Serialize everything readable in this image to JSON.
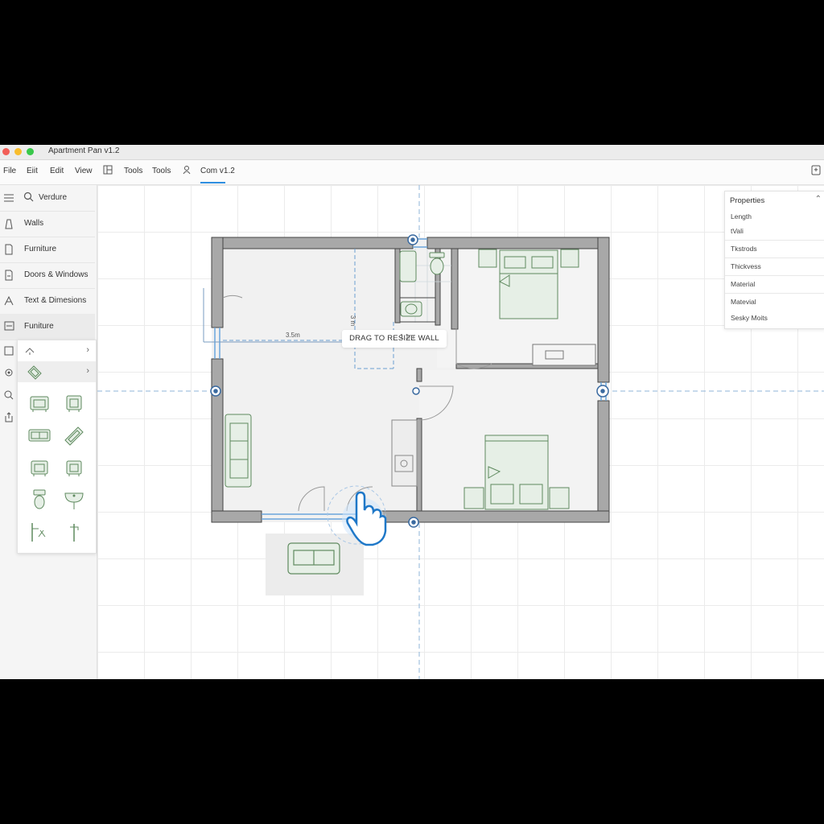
{
  "window": {
    "title": "Apartment Pan v1.2"
  },
  "menu": {
    "items": [
      "File",
      "Eiit",
      "Edit",
      "View",
      "Tools",
      "Tools"
    ],
    "active_tab": "Com v1.2"
  },
  "sidebar": {
    "search_placeholder": "Verdure",
    "items": [
      {
        "label": "Walls",
        "icon": "wall-icon"
      },
      {
        "label": "Furniture",
        "icon": "furniture-icon"
      },
      {
        "label": "Doors & Windows",
        "icon": "door-icon"
      },
      {
        "label": "Text & Dimesions",
        "icon": "text-dimension-icon"
      },
      {
        "label": "Funiture",
        "icon": "furniture-selected-icon",
        "selected": true
      }
    ]
  },
  "palette": {
    "items": [
      "armchair",
      "armchair",
      "loveseat",
      "sofa-angled",
      "armchair",
      "armchair",
      "toilet",
      "sink",
      "faucet-shower",
      "faucet"
    ]
  },
  "canvas": {
    "tooltip": "DRAG TO RESIZE WALL",
    "dimensions": [
      "3.5m",
      "3 m",
      "1.1m"
    ]
  },
  "properties": {
    "title": "Properties",
    "rows": [
      "Length",
      "tVali",
      "Tkstrods",
      "Thickvess",
      "Material",
      "Matevial",
      "Sesky Moits"
    ]
  },
  "colors": {
    "accent": "#2f8fe0",
    "wall": "#9e9e9e",
    "furniture_fill": "#e6efe6",
    "furniture_stroke": "#5f8a5f"
  }
}
